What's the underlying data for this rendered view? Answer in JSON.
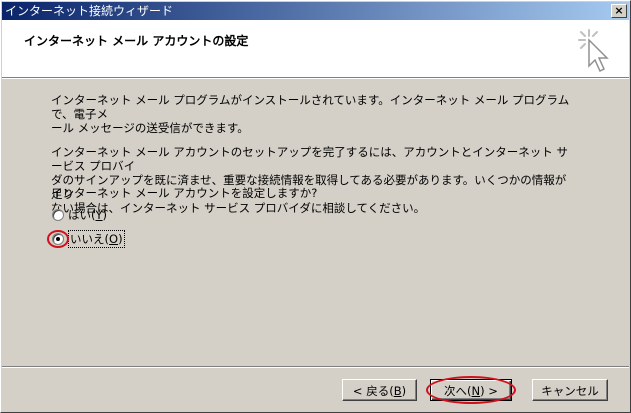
{
  "window": {
    "title": "インターネット接続ウィザード",
    "close_label": "×"
  },
  "header": {
    "title": "インターネット メール アカウントの設定"
  },
  "body": {
    "paragraph1_line1": "インターネット メール プログラムがインストールされています。インターネット メール プログラムで、電子メ",
    "paragraph1_line2": "ール メッセージの送受信ができます。",
    "paragraph2_line1": "インターネット メール アカウントのセットアップを完了するには、アカウントとインターネット サービス プロバイ",
    "paragraph2_line2": "ダのサインアップを既に済ませ、重要な接続情報を取得してある必要があります。いくつかの情報が足り",
    "paragraph2_line3": "ない場合は、インターネット サービス プロバイダに相談してください。",
    "question": "インターネット メール アカウントを設定しますか?"
  },
  "options": {
    "yes_label": "はい(",
    "yes_key": "Y",
    "yes_close": ")",
    "no_label": "いいえ(",
    "no_key": "O",
    "no_close": ")",
    "selected": "no"
  },
  "buttons": {
    "back_label": "< 戻る(",
    "back_key": "B",
    "back_close": ")",
    "next_label": "次へ(",
    "next_key": "N",
    "next_close": ") >",
    "cancel_label": "キャンセル"
  },
  "colors": {
    "highlight_circle": "#d0101c",
    "titlebar_start": "#0a246a",
    "titlebar_end": "#a6caf0"
  }
}
